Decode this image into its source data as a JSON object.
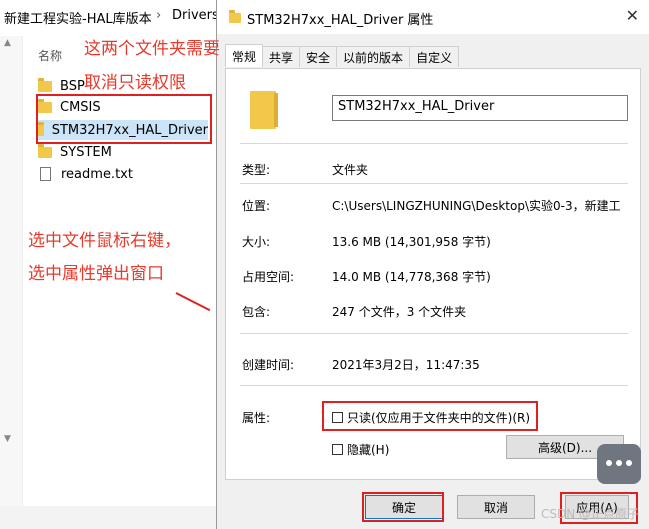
{
  "explorer": {
    "breadcrumb": "新建工程实验-HAL库版本",
    "breadcrumb_current": "Drivers",
    "header_name": "名称",
    "items": [
      {
        "label": "BSP",
        "type": "folder"
      },
      {
        "label": "CMSIS",
        "type": "folder"
      },
      {
        "label": "STM32H7xx_HAL_Driver",
        "type": "folder",
        "selected": true
      },
      {
        "label": "SYSTEM",
        "type": "folder"
      },
      {
        "label": "readme.txt",
        "type": "file"
      }
    ]
  },
  "annotations": {
    "note1_line1": "这两个文件夹需要",
    "note1_line2": "取消只读权限",
    "note2_line1": "选中文件鼠标右键，",
    "note2_line2": "选中属性弹出窗口"
  },
  "dialog": {
    "title": "STM32H7xx_HAL_Driver 属性",
    "close_icon": "✕",
    "tabs": [
      "常规",
      "共享",
      "安全",
      "以前的版本",
      "自定义"
    ],
    "active_tab": "常规",
    "name_value": "STM32H7xx_HAL_Driver",
    "rows": {
      "type_label": "类型:",
      "type_value": "文件夹",
      "location_label": "位置:",
      "location_value": "C:\\Users\\LINGZHUNING\\Desktop\\实验0-3，新建工",
      "size_label": "大小:",
      "size_value": "13.6 MB (14,301,958 字节)",
      "disk_label": "占用空间:",
      "disk_value": "14.0 MB (14,778,368 字节)",
      "contains_label": "包含:",
      "contains_value": "247 个文件，3 个文件夹",
      "created_label": "创建时间:",
      "created_value": "2021年3月2日，11:47:35",
      "attr_label": "属性:"
    },
    "readonly_label": "只读(仅应用于文件夹中的文件)(R)",
    "hidden_label": "隐藏(H)",
    "advanced_button": "高级(D)...",
    "ok_button": "确定",
    "cancel_button": "取消",
    "apply_button": "应用(A)"
  },
  "watermark": "CSDN @正点原子"
}
